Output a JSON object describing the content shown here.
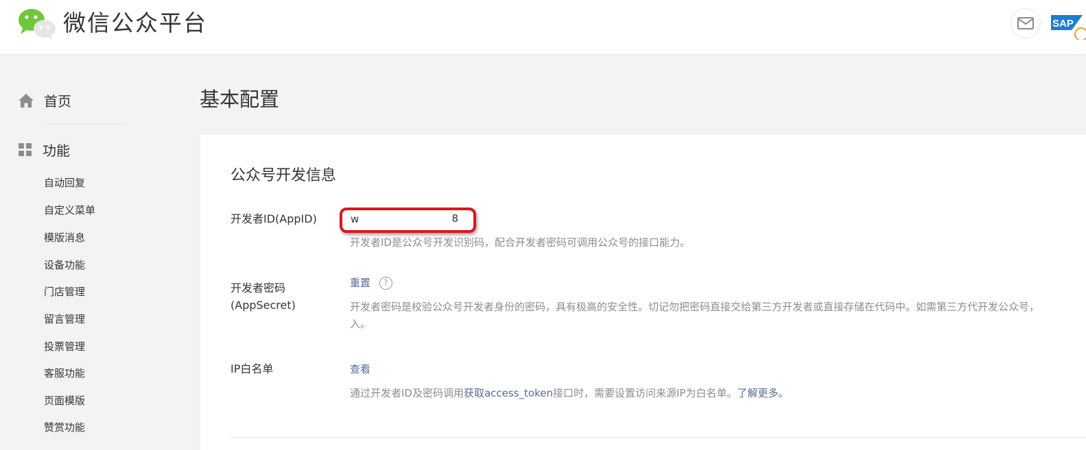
{
  "header": {
    "brand": "微信公众平台",
    "icons": [
      "wechat-logo",
      "mail-icon",
      "sap-logo"
    ],
    "sap_text": "SAP"
  },
  "sidebar": {
    "home_label": "首页",
    "func_label": "功能",
    "items": [
      "自动回复",
      "自定义菜单",
      "模版消息",
      "设备功能",
      "门店管理",
      "留言管理",
      "投票管理",
      "客服功能",
      "页面模版",
      "赞赏功能"
    ]
  },
  "main": {
    "page_title": "基本配置",
    "section_title": "公众号开发信息",
    "appid": {
      "label": "开发者ID(AppID)",
      "value_start": "w",
      "value_end": "8",
      "desc": "开发者ID是公众号开发识别码，配合开发者密码可调用公众号的接口能力。"
    },
    "secret": {
      "label_line1": "开发者密码",
      "label_line2": "(AppSecret)",
      "reset_link": "重置",
      "help": "?",
      "desc_line1": "开发者密码是校验公众号开发者身份的密码，具有极高的安全性。切记勿把密码直接交给第三方开发者或直接存储在代码中。如需第三方代开发公众号，",
      "desc_line2": "入。"
    },
    "ip_whitelist": {
      "label": "IP白名单",
      "view_link": "查看",
      "desc_prefix": "通过开发者ID及密码调用",
      "desc_link": "获取access_token",
      "desc_middle": "接口时，需要设置访问来源IP为白名单。",
      "learn_more": "了解更多。"
    }
  },
  "colors": {
    "link": "#576b95",
    "highlight_border": "#e0141c",
    "wechat_green": "#6fc73e"
  }
}
